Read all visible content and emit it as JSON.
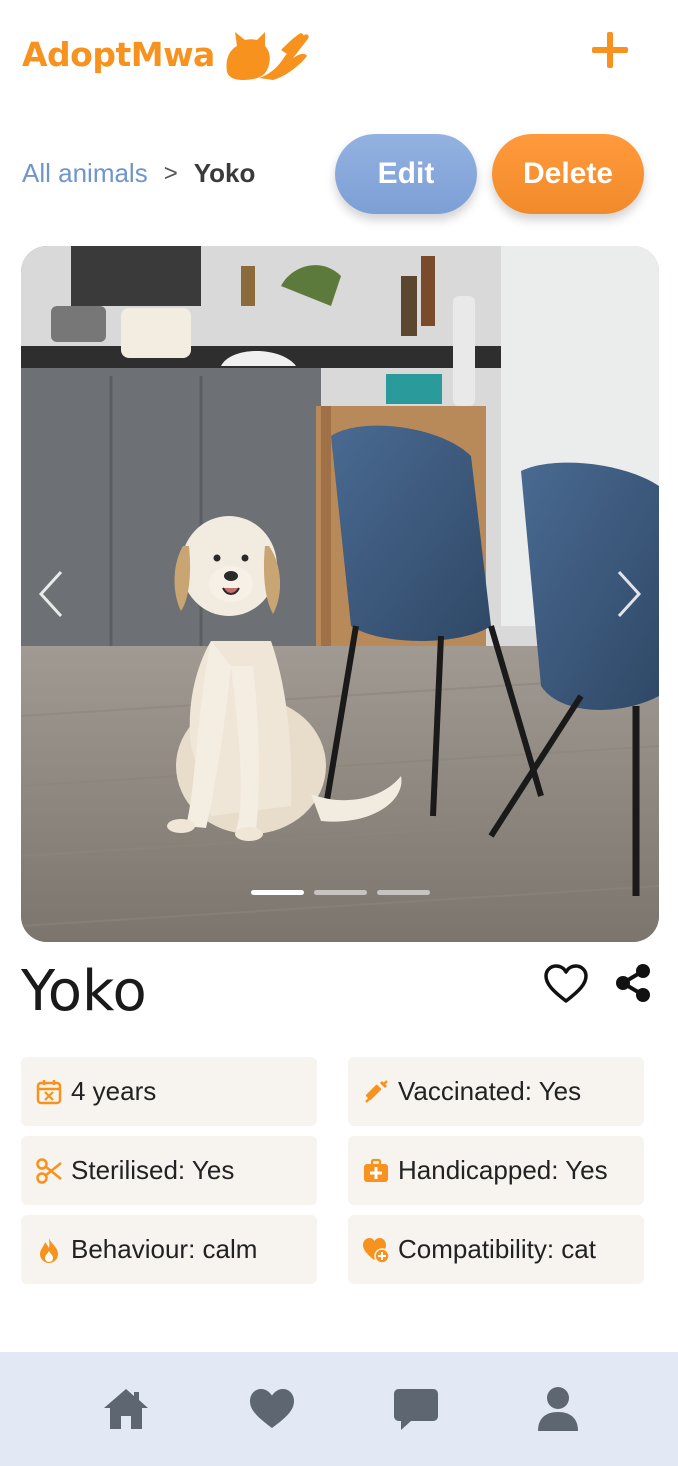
{
  "app": {
    "logo_text": "AdoptMwa",
    "brand_color": "#F7921E",
    "accent_blue": "#7D9FD5"
  },
  "breadcrumb": {
    "root": "All animals",
    "separator": ">",
    "current": "Yoko"
  },
  "actions": {
    "edit_label": "Edit",
    "delete_label": "Delete"
  },
  "carousel": {
    "slide_count": 3,
    "active_index": 0,
    "image_desc": "dog-photo"
  },
  "pet": {
    "name": "Yoko"
  },
  "facts": [
    {
      "icon": "calendar-icon",
      "text": "4 years"
    },
    {
      "icon": "syringe-icon",
      "text": "Vaccinated: Yes"
    },
    {
      "icon": "scissors-icon",
      "text": "Sterilised: Yes"
    },
    {
      "icon": "medkit-icon",
      "text": "Handicapped: Yes"
    },
    {
      "icon": "flame-icon",
      "text": "Behaviour: calm"
    },
    {
      "icon": "heart-plus-icon",
      "text": "Compatibility: cat"
    }
  ],
  "bottom_nav": [
    {
      "icon": "home-icon"
    },
    {
      "icon": "heart-icon"
    },
    {
      "icon": "chat-icon"
    },
    {
      "icon": "user-icon"
    }
  ]
}
